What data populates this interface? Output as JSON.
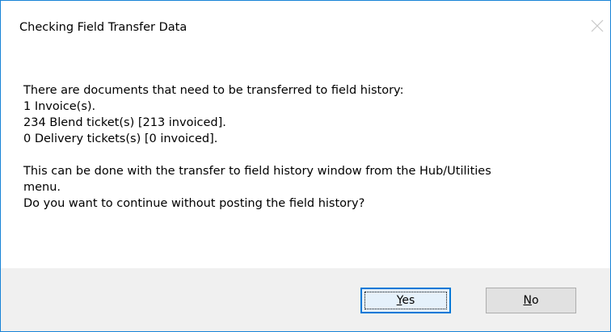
{
  "window": {
    "title": "Checking Field Transfer Data",
    "close_icon": "close-icon"
  },
  "message": {
    "line1": "There are documents that need to be transferred to field history:",
    "line2": "1 Invoice(s).",
    "line3": "234 Blend ticket(s) [213 invoiced].",
    "line4": "0 Delivery tickets(s) [0 invoiced].",
    "line5": "This can be done with the transfer to field history window from the Hub/Utilities",
    "line6": "menu.",
    "line7": "Do you want to continue without posting the field history?"
  },
  "buttons": {
    "yes": {
      "mnemonic": "Y",
      "rest": "es"
    },
    "no": {
      "mnemonic": "N",
      "rest": "o"
    }
  },
  "colors": {
    "border": "#1883d7",
    "footer_bg": "#f0f0f0",
    "default_button_border": "#0078d7"
  }
}
